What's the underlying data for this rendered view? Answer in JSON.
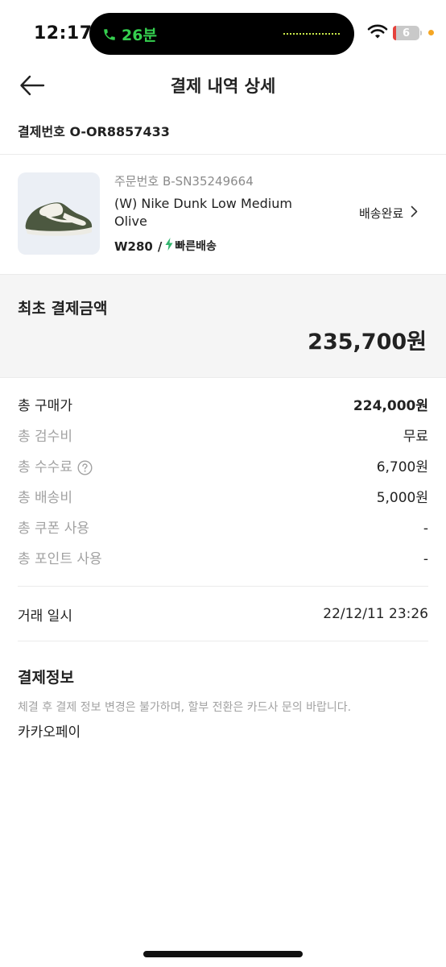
{
  "status_bar": {
    "time": "12:17",
    "call_duration": "26분",
    "battery": "6",
    "icons": [
      "phone-icon",
      "wifi-icon",
      "battery-icon"
    ]
  },
  "header": {
    "title": "결제 내역 상세",
    "back_icon": "arrow-left-icon"
  },
  "payment_number": "결제번호 O-OR8857433",
  "product": {
    "order_number": "주문번호 B-SN35249664",
    "name": "(W) Nike Dunk Low Medium Olive",
    "size": "W280",
    "separator": "/",
    "delivery_type": "빠른배송",
    "status": "배송완료",
    "image_icon": "sneaker-image"
  },
  "summary": {
    "label": "최초 결제금액",
    "amount": "235,700원"
  },
  "fees": [
    {
      "label": "총 구매가",
      "value": "224,000원"
    },
    {
      "label": "총 검수비",
      "value": "무료"
    },
    {
      "label": "총 수수료",
      "value": "6,700원"
    },
    {
      "label": "총 배송비",
      "value": "5,000원"
    },
    {
      "label": "총 쿠폰 사용",
      "value": "-"
    },
    {
      "label": "총 포인트 사용",
      "value": "-"
    }
  ],
  "trade": {
    "label": "거래 일시",
    "value": "22/12/11 23:26"
  },
  "payment_info": {
    "title": "결제정보",
    "note": "체결 후 결제 정보 변경은 불가하며, 할부 전환은 카드사 문의 바랍니다.",
    "method": "카카오페이"
  },
  "colors": {
    "text": "#222222",
    "muted": "#a2a2a2",
    "summary_bg": "#f5f5f5",
    "fast_delivery": "#31b46e",
    "call_green": "#35d04f"
  }
}
